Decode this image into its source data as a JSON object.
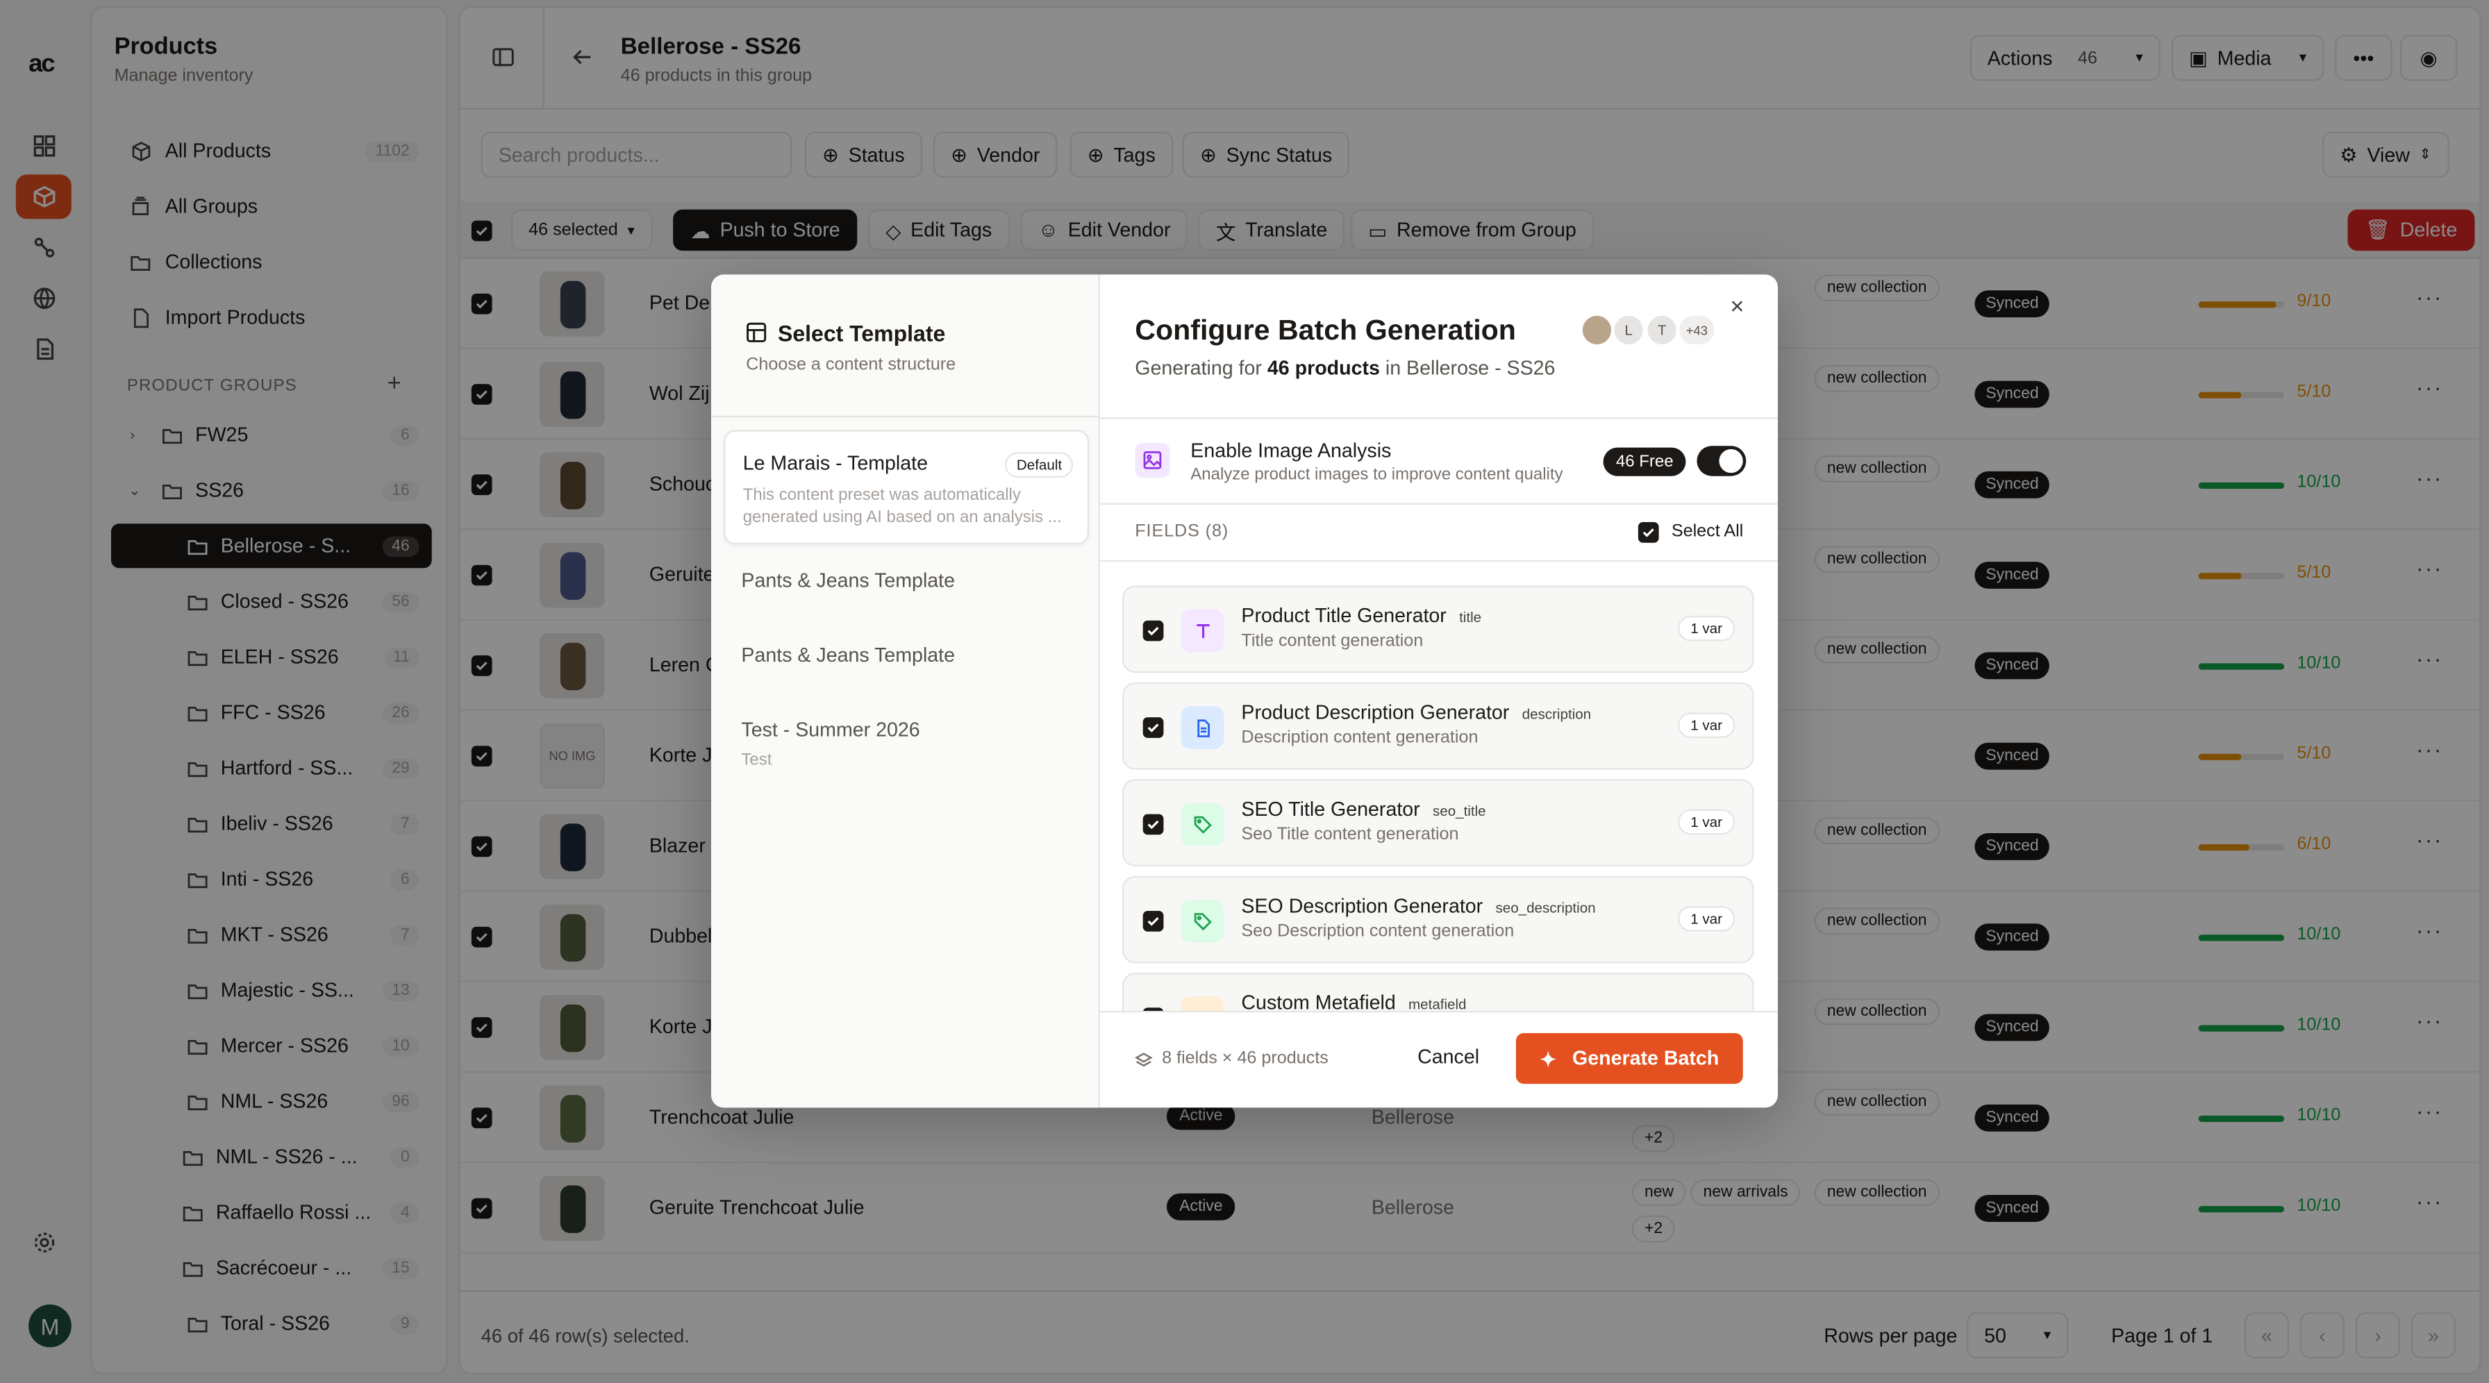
{
  "sidebar": {
    "title": "Products",
    "subtitle": "Manage inventory",
    "nav": [
      {
        "label": "All Products",
        "count": "1102"
      },
      {
        "label": "All Groups",
        "count": ""
      },
      {
        "label": "Collections",
        "count": ""
      },
      {
        "label": "Import Products",
        "count": ""
      }
    ],
    "groups_heading": "PRODUCT GROUPS",
    "groups": [
      {
        "label": "FW25",
        "count": "6"
      },
      {
        "label": "SS26",
        "count": "16"
      },
      {
        "label": "Bellerose - S...",
        "count": "46"
      },
      {
        "label": "Closed - SS26",
        "count": "56"
      },
      {
        "label": "ELEH - SS26",
        "count": "11"
      },
      {
        "label": "FFC - SS26",
        "count": "26"
      },
      {
        "label": "Hartford - SS...",
        "count": "29"
      },
      {
        "label": "Ibeliv - SS26",
        "count": "7"
      },
      {
        "label": "Inti - SS26",
        "count": "6"
      },
      {
        "label": "MKT - SS26",
        "count": "7"
      },
      {
        "label": "Majestic - SS...",
        "count": "13"
      },
      {
        "label": "Mercer - SS26",
        "count": "10"
      },
      {
        "label": "NML - SS26",
        "count": "96"
      },
      {
        "label": "NML - SS26 - ...",
        "count": "0"
      },
      {
        "label": "Raffaello Rossi ...",
        "count": "4"
      },
      {
        "label": "Sacrécoeur - ...",
        "count": "15"
      },
      {
        "label": "Toral - SS26",
        "count": "9"
      }
    ],
    "avatar_letter": "M"
  },
  "header": {
    "title": "Bellerose - SS26",
    "subtitle": "46 products in this group",
    "actions_label": "Actions",
    "actions_count": "46",
    "media_label": "Media"
  },
  "filters": {
    "search_placeholder": "Search products...",
    "status": "Status",
    "vendor": "Vendor",
    "tags": "Tags",
    "sync_status": "Sync Status",
    "view": "View"
  },
  "bulk": {
    "selected": "46 selected",
    "push": "Push to Store",
    "edit_tags": "Edit Tags",
    "edit_vendor": "Edit Vendor",
    "translate": "Translate",
    "remove": "Remove from Group",
    "delete": "Delete"
  },
  "rows": [
    {
      "name": "Pet Del",
      "tag": "new collection",
      "sync": "Synced",
      "score": "9/10",
      "pct": 0.9,
      "color": "#e8900c",
      "thumb": "#374151",
      "status": "",
      "vendor": "",
      "extra": ""
    },
    {
      "name": "Wol Zij",
      "tag": "new collection",
      "sync": "Synced",
      "score": "5/10",
      "pct": 0.5,
      "color": "#e8900c",
      "thumb": "#1f2937",
      "status": "",
      "vendor": "",
      "extra": ""
    },
    {
      "name": "Schouc",
      "tag": "new collection",
      "sync": "Synced",
      "score": "10/10",
      "pct": 1,
      "color": "#16a34a",
      "thumb": "#5b4a30",
      "status": "",
      "vendor": "",
      "extra": ""
    },
    {
      "name": "Geruite",
      "tag": "new collection",
      "sync": "Synced",
      "score": "5/10",
      "pct": 0.5,
      "color": "#e8900c",
      "thumb": "#4b5a8a",
      "status": "",
      "vendor": "",
      "extra": ""
    },
    {
      "name": "Leren C",
      "tag": "new collection",
      "sync": "Synced",
      "score": "10/10",
      "pct": 1,
      "color": "#16a34a",
      "thumb": "#6b5a40",
      "status": "",
      "vendor": "",
      "extra": ""
    },
    {
      "name": "Korte J",
      "tag": "",
      "sync": "Synced",
      "score": "5/10",
      "pct": 0.5,
      "color": "#e8900c",
      "thumb": "",
      "noimg": "NO IMG",
      "status": "",
      "vendor": "",
      "extra": ""
    },
    {
      "name": "Blazer I",
      "tag": "new collection",
      "sync": "Synced",
      "score": "6/10",
      "pct": 0.6,
      "color": "#e8900c",
      "thumb": "#1e293b",
      "status": "",
      "vendor": "",
      "extra": ""
    },
    {
      "name": "Dubbel",
      "tag": "new collection",
      "sync": "Synced",
      "score": "10/10",
      "pct": 1,
      "color": "#16a34a",
      "thumb": "#55603f",
      "status": "",
      "vendor": "",
      "extra": ""
    },
    {
      "name": "Korte J",
      "tag": "new collection",
      "sync": "Synced",
      "score": "10/10",
      "pct": 1,
      "color": "#16a34a",
      "thumb": "#4f5a3a",
      "status": "",
      "vendor": "",
      "extra": ""
    },
    {
      "name": "Trenchcoat Julie",
      "tag": "new collection",
      "sync": "Synced",
      "score": "10/10",
      "pct": 1,
      "color": "#16a34a",
      "thumb": "#5a6a3e",
      "status": "Active",
      "vendor": "Bellerose",
      "extra": "+2"
    },
    {
      "name": "Geruite Trenchcoat Julie",
      "tag": "new collection",
      "tag2": "new",
      "tag3": "new arrivals",
      "sync": "Synced",
      "score": "10/10",
      "pct": 1,
      "color": "#16a34a",
      "thumb": "#2f3b2a",
      "status": "Active",
      "vendor": "Bellerose",
      "extra": "+2"
    }
  ],
  "footer": {
    "selected_text": "46 of 46 row(s) selected.",
    "rows_per_page_label": "Rows per page",
    "rows_per_page": "50",
    "page": "Page 1 of 1"
  },
  "modal": {
    "left_title": "Select Template",
    "left_sub": "Choose a content structure",
    "templates": [
      {
        "name": "Le Marais - Template",
        "badge": "Default",
        "desc": "This content preset was automatically generated using AI based on an analysis ..."
      },
      {
        "name": "Pants & Jeans Template",
        "badge": "",
        "desc": ""
      },
      {
        "name": "Pants & Jeans Template",
        "badge": "",
        "desc": ""
      },
      {
        "name": "Test - Summer 2026",
        "badge": "",
        "desc": "Test"
      }
    ],
    "title": "Configure Batch Generation",
    "gen_prefix": "Generating for",
    "gen_count": "46 products",
    "gen_suffix": "in Bellerose - SS26",
    "avatars": [
      "L",
      "T",
      "+43"
    ],
    "image_analysis_title": "Enable Image Analysis",
    "image_analysis_sub": "Analyze product images to improve content quality",
    "free_badge": "46 Free",
    "fields_heading": "FIELDS (8)",
    "select_all": "Select All",
    "fields": [
      {
        "title": "Product Title Generator",
        "tag": "title",
        "sub": "Title content generation",
        "var": "1 var",
        "icon": "text-icon",
        "bg": "#f3e8ff",
        "fg": "#9333ea"
      },
      {
        "title": "Product Description Generator",
        "tag": "description",
        "sub": "Description content generation",
        "var": "1 var",
        "icon": "document-icon",
        "bg": "#dbeafe",
        "fg": "#2563eb"
      },
      {
        "title": "SEO Title Generator",
        "tag": "seo_title",
        "sub": "Seo Title content generation",
        "var": "1 var",
        "icon": "tag-icon",
        "bg": "#dcfce7",
        "fg": "#16a34a"
      },
      {
        "title": "SEO Description Generator",
        "tag": "seo_description",
        "sub": "Seo Description content generation",
        "var": "1 var",
        "icon": "tag-icon",
        "bg": "#dcfce7",
        "fg": "#16a34a"
      },
      {
        "title": "Custom Metafield",
        "tag": "metafield",
        "sub": "",
        "var": "",
        "icon": "code-icon",
        "bg": "#ffedd5",
        "fg": "#ea580c"
      }
    ],
    "summary": "8 fields × 46 products",
    "cancel": "Cancel",
    "generate": "Generate Batch"
  }
}
